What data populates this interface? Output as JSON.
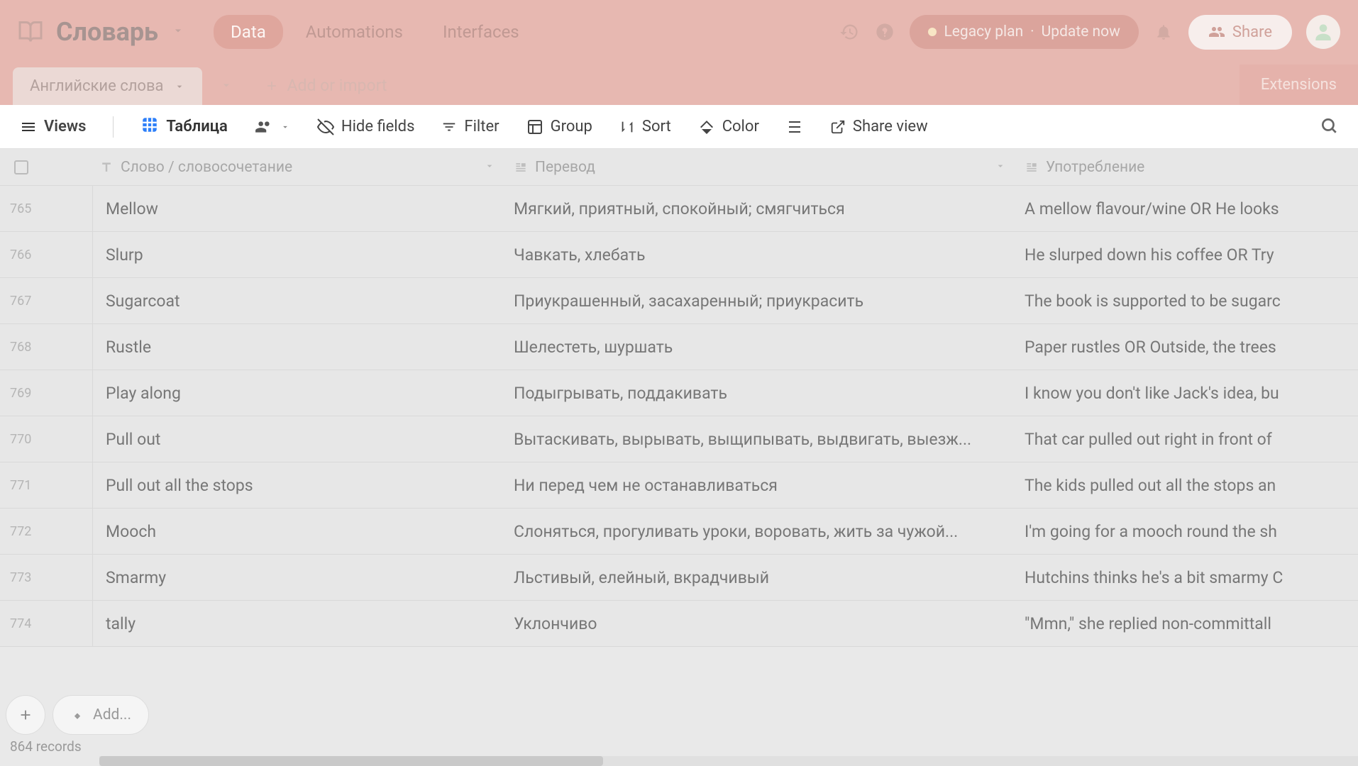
{
  "header": {
    "app_title": "Словарь",
    "nav": {
      "data": "Data",
      "automations": "Automations",
      "interfaces": "Interfaces"
    },
    "plan": {
      "legacy": "Legacy plan",
      "separator": " · ",
      "update": "Update now"
    },
    "share": "Share"
  },
  "tabs": {
    "table_name": "Английские слова",
    "add_import": "Add or import",
    "extensions": "Extensions"
  },
  "toolbar": {
    "views": "Views",
    "view_name": "Таблица",
    "hide_fields": "Hide fields",
    "filter": "Filter",
    "group": "Group",
    "sort": "Sort",
    "color": "Color",
    "share_view": "Share view"
  },
  "columns": {
    "word": "Слово / словосочетание",
    "translation": "Перевод",
    "usage": "Употребление"
  },
  "rows": [
    {
      "num": "765",
      "word": "Mellow",
      "translation": "Мягкий, приятный, спокойный; смягчиться",
      "usage": "A mellow flavour/wine OR He looks"
    },
    {
      "num": "766",
      "word": "Slurp",
      "translation": "Чавкать, хлебать",
      "usage": "He slurped down his coffee OR Try"
    },
    {
      "num": "767",
      "word": "Sugarcoat",
      "translation": "Приукрашенный, засахаренный; приукрасить",
      "usage": "The book is supported to be sugarc"
    },
    {
      "num": "768",
      "word": "Rustle",
      "translation": "Шелестеть, шуршать",
      "usage": "Paper rustles OR Outside, the trees"
    },
    {
      "num": "769",
      "word": "Play along",
      "translation": "Подыгрывать, поддакивать",
      "usage": "I know you don't like Jack's idea, bu"
    },
    {
      "num": "770",
      "word": "Pull out",
      "translation": "Вытаскивать, вырывать, выщипывать, выдвигать, выезж...",
      "usage": "That car pulled out right in front of"
    },
    {
      "num": "771",
      "word": "Pull out all the stops",
      "translation": "Ни перед чем не останавливаться",
      "usage": "The kids pulled out all the stops an"
    },
    {
      "num": "772",
      "word": "Mooch",
      "translation": "Слоняться, прогуливать уроки, воровать, жить за чужой...",
      "usage": "I'm going for a mooch round the sh"
    },
    {
      "num": "773",
      "word": "Smarmy",
      "translation": "Льстивый, елейный, вкрадчивый",
      "usage": "Hutchins thinks he's a bit smarmy C"
    },
    {
      "num": "774",
      "word": "tally",
      "translation": "Уклончиво",
      "usage": "\"Mmn,\" she replied non-committall"
    }
  ],
  "footer": {
    "add": "Add...",
    "records": "864 records"
  }
}
